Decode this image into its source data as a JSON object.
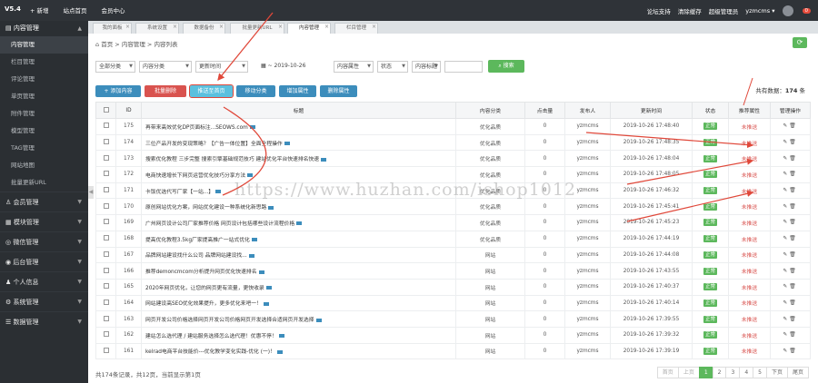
{
  "brand": "V5.4",
  "topnav": [
    "+ 新增",
    "站点首页",
    "会员中心"
  ],
  "topright": {
    "support": "论坛支持",
    "clear": "清除缓存",
    "admin": "超级管理员",
    "user": "yzmcms",
    "badge": "0"
  },
  "sidebar": {
    "group": "内容管理",
    "subs": [
      "内容管理",
      "栏目管理",
      "评论管理",
      "单页管理",
      "附件管理",
      "模型管理",
      "TAG管理",
      "网站地图",
      "批量更新URL"
    ],
    "sections": [
      "会员管理",
      "模块管理",
      "微信管理",
      "后台管理",
      "个人信息",
      "系统管理",
      "数据管理"
    ]
  },
  "tabs": [
    "我的面板",
    "系统设置",
    "数据备份",
    "批量更新URL",
    "内容管理",
    "栏目管理"
  ],
  "breadcrumb": {
    "home": "首页",
    "sep": ">",
    "section": "内容管理",
    "page": "内容列表"
  },
  "filters": {
    "type": "全部分类",
    "category": "内容分类",
    "search": "更新时间",
    "date": "2019-10-26",
    "attr": "内容属性",
    "status": "状态",
    "keyword": "内容标题",
    "search_btn": "搜索"
  },
  "actions": [
    "+ 添加内容",
    "批量删除",
    "推送至首页",
    "移动分类",
    "增加属性",
    "删除属性"
  ],
  "total_label": "共有数据：",
  "total_count": "174",
  "total_unit": "条",
  "columns": [
    "",
    "ID",
    "标题",
    "内容分类",
    "点击量",
    "发布人",
    "更新时间",
    "状态",
    "推荐属性",
    "管理操作"
  ],
  "rows": [
    {
      "id": "175",
      "title": "再带来高效优化DP页面标注...SEOWS.com",
      "cat": "优化品质",
      "hits": "0",
      "user": "yzmcms",
      "time": "2019-10-26 17:48:40",
      "status": "正常",
      "rec": "未推送"
    },
    {
      "id": "174",
      "title": "三位产品开发的变现策略？【广告一体位置】全面全程操作",
      "cat": "优化品质",
      "hits": "0",
      "user": "yzmcms",
      "time": "2019-10-26 17:48:35",
      "status": "正常",
      "rec": "未推送"
    },
    {
      "id": "173",
      "title": "搜索优化教程 三步完整 搜索引擎基础规范技巧 建站优化平台快速排名快速",
      "cat": "优化品质",
      "hits": "0",
      "user": "yzmcms",
      "time": "2019-10-26 17:48:04",
      "status": "正常",
      "rec": "未推送"
    },
    {
      "id": "172",
      "title": "电商快速增长下网页运营优化技巧分享方法",
      "cat": "优化品质",
      "hits": "0",
      "user": "yzmcms",
      "time": "2019-10-26 17:48:05",
      "status": "正常",
      "rec": "未推送"
    },
    {
      "id": "171",
      "title": "卡饭优选代写厂家【一站...】",
      "cat": "优化品质",
      "hits": "0",
      "user": "yzmcms",
      "time": "2019-10-26 17:46:32",
      "status": "正常",
      "rec": "未推送"
    },
    {
      "id": "170",
      "title": "原创网站优化方案，网站优化建设一种系统化新思路",
      "cat": "优化品质",
      "hits": "0",
      "user": "yzmcms",
      "time": "2019-10-26 17:45:41",
      "status": "正常",
      "rec": "未推送"
    },
    {
      "id": "169",
      "title": "广州网页设计公司厂家推荐价格 网页设计包括哪些设计流程价格",
      "cat": "优化品质",
      "hits": "0",
      "user": "yzmcms",
      "time": "2019-10-26 17:45:23",
      "status": "正常",
      "rec": "未推送"
    },
    {
      "id": "168",
      "title": "提高优化教程3.5kg厂家提高推广一站式优化",
      "cat": "优化品质",
      "hits": "0",
      "user": "yzmcms",
      "time": "2019-10-26 17:44:19",
      "status": "正常",
      "rec": "未推送"
    },
    {
      "id": "167",
      "title": "品牌网站建设找什么公司 品牌网站建设找...",
      "cat": "网站",
      "hits": "0",
      "user": "yzmcms",
      "time": "2019-10-26 17:44:08",
      "status": "正常",
      "rec": "未推送"
    },
    {
      "id": "166",
      "title": "推荐demoncmcom分析提升网页优化快速排名",
      "cat": "网站",
      "hits": "0",
      "user": "yzmcms",
      "time": "2019-10-26 17:43:55",
      "status": "正常",
      "rec": "未推送"
    },
    {
      "id": "165",
      "title": "2020年网页优化，让您的网页更有流量，更快收录",
      "cat": "网站",
      "hits": "0",
      "user": "yzmcms",
      "time": "2019-10-26 17:40:37",
      "status": "正常",
      "rec": "未推送"
    },
    {
      "id": "164",
      "title": "网站建设高SEO优化效果提升，更多优化来吧一！",
      "cat": "网站",
      "hits": "0",
      "user": "yzmcms",
      "time": "2019-10-26 17:40:14",
      "status": "正常",
      "rec": "未推送"
    },
    {
      "id": "163",
      "title": "网页开发公司价格选择网页开发公司价格网页开发选择合适网页开发选择",
      "cat": "网站",
      "hits": "0",
      "user": "yzmcms",
      "time": "2019-10-26 17:39:55",
      "status": "正常",
      "rec": "未推送"
    },
    {
      "id": "162",
      "title": "建站怎么选代理 / 建站服务选择怎么选代理！优惠不停！",
      "cat": "网站",
      "hits": "0",
      "user": "yzmcms",
      "time": "2019-10-26 17:39:32",
      "status": "正常",
      "rec": "未推送"
    },
    {
      "id": "161",
      "title": "kelrad电商平台技能价---优化教学变化实践-优化 (一)！",
      "cat": "网站",
      "hits": "0",
      "user": "yzmcms",
      "time": "2019-10-26 17:39:19",
      "status": "正常",
      "rec": "未推送"
    }
  ],
  "footer": "共174条记录，共12页，当前显示第1页",
  "pager": [
    "首页",
    "上页",
    "1",
    "2",
    "3",
    "4",
    "5",
    "下页",
    "尾页"
  ],
  "watermark": "https://www.huzhan.com/ishop1012",
  "colors": {
    "accent": "#5cb85c",
    "primary": "#3c8dbc",
    "danger": "#d9534f",
    "annotation": "#e0483a"
  }
}
